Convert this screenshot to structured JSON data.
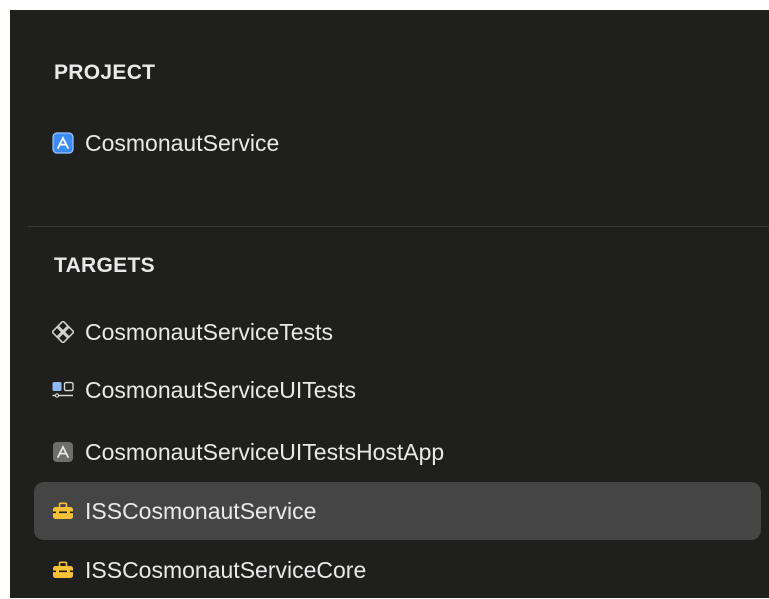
{
  "project": {
    "header": "PROJECT",
    "items": [
      {
        "label": "CosmonautService",
        "icon": "app-project-icon"
      }
    ]
  },
  "targets": {
    "header": "TARGETS",
    "items": [
      {
        "label": "CosmonautServiceTests",
        "icon": "unit-tests-icon"
      },
      {
        "label": "CosmonautServiceUITests",
        "icon": "ui-tests-icon"
      },
      {
        "label": "CosmonautServiceUITestsHostApp",
        "icon": "host-app-icon"
      },
      {
        "label": "ISSCosmonautService",
        "icon": "toolbox-icon",
        "selected": true
      },
      {
        "label": "ISSCosmonautServiceCore",
        "icon": "toolbox-icon"
      }
    ]
  },
  "colors": {
    "background": "#1f1f1e",
    "text": "#e9e9e9",
    "selection": "#454545",
    "accent_blue": "#3b8cf7",
    "toolbox_yellow": "#f6c137"
  }
}
